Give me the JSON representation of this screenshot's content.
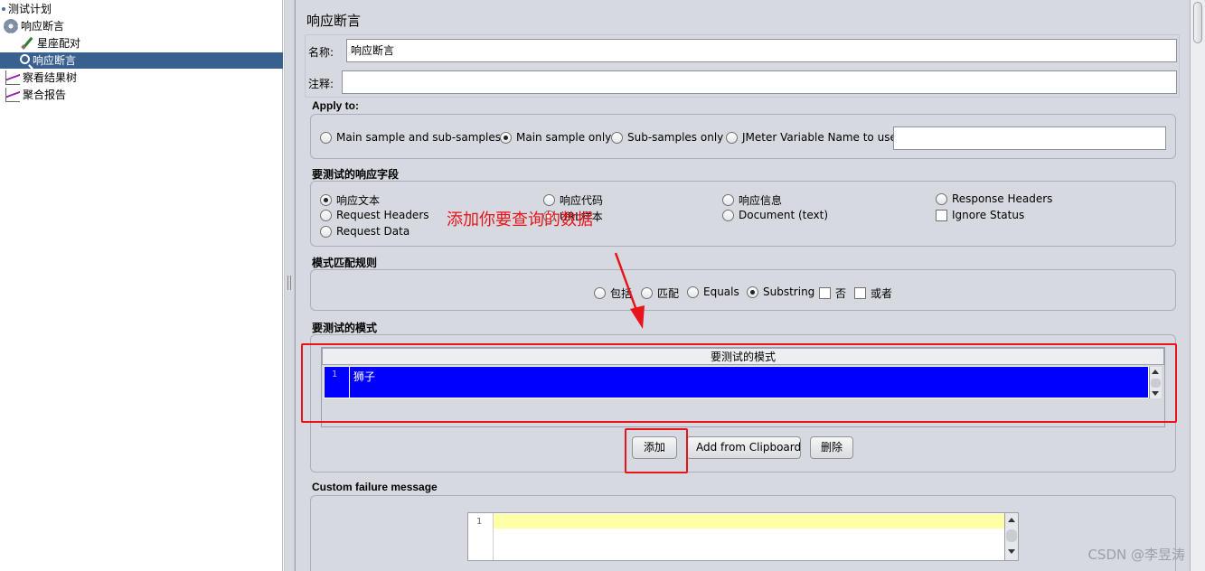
{
  "tree": {
    "items": [
      {
        "label": "测试计划",
        "icon": "test-plan-icon"
      },
      {
        "label": "响应断言",
        "icon": "gear-icon"
      },
      {
        "label": "星座配对",
        "icon": "sampler-pen-icon"
      },
      {
        "label": "响应断言",
        "icon": "magnifier-icon",
        "selected": true
      },
      {
        "label": "察看结果树",
        "icon": "graph-icon"
      },
      {
        "label": "聚合报告",
        "icon": "graph-icon"
      }
    ]
  },
  "panel": {
    "title": "响应断言",
    "name_label": "名称:",
    "name_value": "响应断言",
    "comment_label": "注释:",
    "comment_value": ""
  },
  "apply_to": {
    "title": "Apply to:",
    "options": [
      "Main sample and sub-samples",
      "Main sample only",
      "Sub-samples only",
      "JMeter Variable Name to use"
    ],
    "selected": "Main sample only",
    "variable_value": ""
  },
  "field_to_test": {
    "title": "要测试的响应字段",
    "options": [
      "响应文本",
      "响应代码",
      "响应信息",
      "Response Headers",
      "Request Headers",
      "URL样本",
      "Document (text)",
      "Ignore Status",
      "Request Data"
    ],
    "selected": "响应文本"
  },
  "pattern_rules": {
    "title": "模式匹配规则",
    "options": [
      "包括",
      "匹配",
      "Equals",
      "Substring",
      "否",
      "或者"
    ],
    "selected": "Substring"
  },
  "patterns": {
    "section_title": "要测试的模式",
    "column_header": "要测试的模式",
    "rows": [
      {
        "line": "1",
        "value": "狮子"
      }
    ],
    "buttons": {
      "add": "添加",
      "add_clipboard": "Add from Clipboard",
      "delete": "删除"
    }
  },
  "failure": {
    "title": "Custom failure message",
    "line": "1"
  },
  "annotation": {
    "note": "添加你要查询的数据",
    "color": "#e8141b"
  },
  "watermark": "CSDN @李昱涛",
  "colors": {
    "selection": "#39618f",
    "row_selected": "#0000ff",
    "panel_bg": "#d6d9df",
    "editor_line": "#ffffa8"
  }
}
